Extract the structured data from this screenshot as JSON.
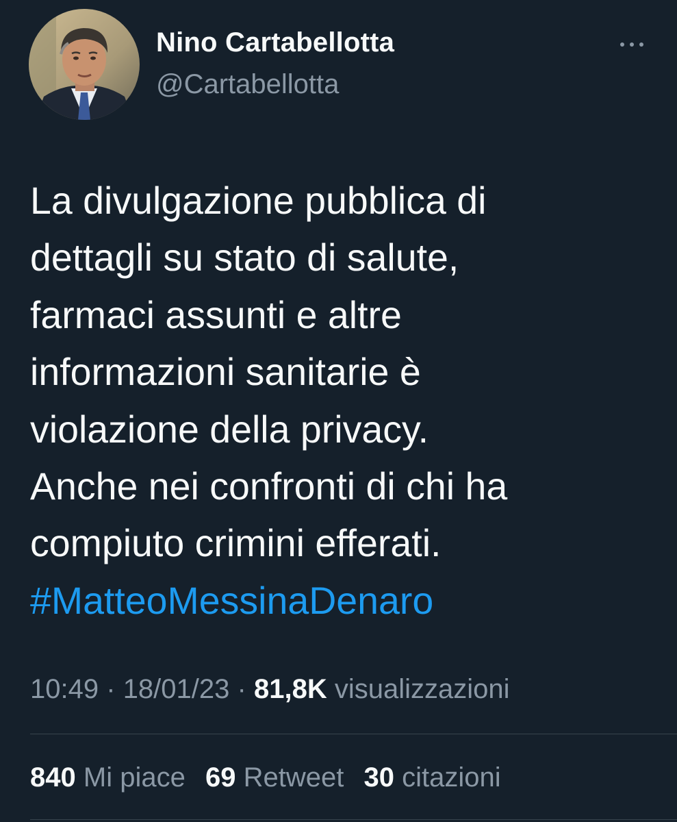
{
  "author": {
    "display_name": "Nino Cartabellotta",
    "handle": "@Cartabellotta",
    "avatar_icon": "profile-photo"
  },
  "more_icon": "more-horizontal-icon",
  "tweet": {
    "lines": [
      "La divulgazione pubblica di",
      "dettagli su stato di salute,",
      "farmaci assunti e altre",
      "informazioni sanitarie è",
      "violazione della privacy.",
      "Anche nei confronti di chi ha",
      "compiuto crimini efferati."
    ],
    "hashtag": "#MatteoMessinaDenaro"
  },
  "meta": {
    "time": "10:49",
    "separator": "·",
    "date": "18/01/23",
    "views_count": "81,8K",
    "views_label": "visualizzazioni"
  },
  "stats": {
    "likes_count": "840",
    "likes_label": "Mi piace",
    "retweets_count": "69",
    "retweets_label": "Retweet",
    "quotes_count": "30",
    "quotes_label": "citazioni"
  },
  "colors": {
    "background": "#15202b",
    "text_primary": "#f7f9f9",
    "text_secondary": "#8b98a5",
    "link": "#1d9bf0",
    "divider": "#38444d"
  }
}
